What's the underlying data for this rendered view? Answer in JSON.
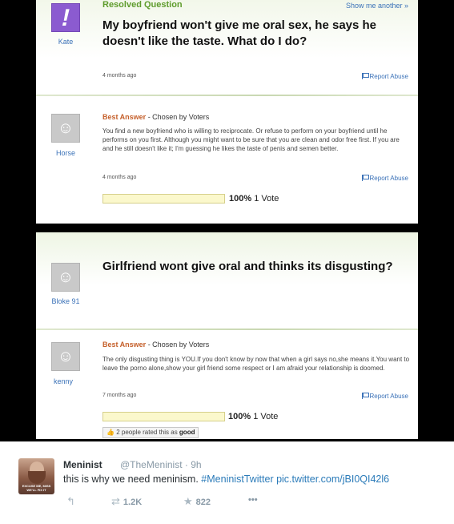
{
  "question1": {
    "status": "Resolved Question",
    "show_another": "Show me another »",
    "asker": "Kate",
    "title": "My boyfriend won't give me oral sex, he says he doesn't like the taste. What do I do?",
    "asked_ago": "4 months ago",
    "report_label": "Report Abuse",
    "best_answer_label": "Best Answer",
    "chosen_by": " - Chosen by Voters",
    "answerer": "Horse",
    "answer": "You find a new boyfriend who is willing to reciprocate. Or refuse to perform on your boyfriend until he performs on you first. Although you might want to be sure that you are clean and odor free first. If you are and he still doesn't like it; I'm guessing he likes the taste of penis and semen better.",
    "answered_ago": "4 months ago",
    "vote_percent": "100%",
    "vote_count": "1 Vote",
    "vote_fraction": 1.0
  },
  "question2": {
    "asker": "Bloke 91",
    "title": "Girlfriend wont give oral and thinks its disgusting?",
    "best_answer_label": "Best Answer",
    "chosen_by": " - Chosen by Voters",
    "answerer": "kenny",
    "answer": "The only disgusting thing is YOU.If you don't know by now that when a girl says no,she means it.You want to leave the porno alone,show your girl friend some respect or I am afraid your relationship is doomed.",
    "answered_ago": "7 months ago",
    "report_label": "Report Abuse",
    "vote_percent": "100%",
    "vote_count": "1 Vote",
    "vote_fraction": 1.0,
    "rated_text": "2 people rated this as ",
    "rated_value": "good"
  },
  "tweet": {
    "name": "Meninist",
    "handle": "@TheMeninist · 9h",
    "text_plain": "this is why we need meninism. ",
    "hashtag": "#MeninistTwitter",
    "link": " pic.twitter.com/jBI0QI42l6",
    "avatar_caption": "EXCUSE ME, MISS WE'LL FIX IT",
    "retweets": "1.2K",
    "favorites": "822",
    "more": "•••"
  },
  "colors": {
    "link_blue": "#3b72b8",
    "resolved_green": "#5e9c2c",
    "best_answer_orange": "#c5602b",
    "twitter_blue": "#2b7bb9"
  }
}
